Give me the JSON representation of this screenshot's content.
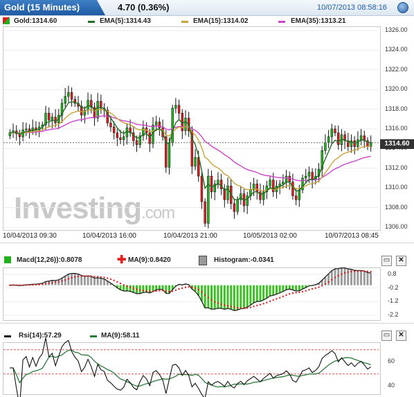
{
  "header": {
    "title": "Gold (15 Minutes)",
    "change": "4.70 (0.36%)",
    "datetime": "10/07/2013 08:58:16"
  },
  "legend_main": {
    "symbol": "Gold:1314.60",
    "ema5": "EMA(5):1314.43",
    "ema15": "EMA(15):1314.02",
    "ema35": "EMA(35):1313.21"
  },
  "legend_macd": {
    "macd": "Macd(12,26)):0.8078",
    "ma": "MA(9):0.8420",
    "hist": "Histogram:-0.0341"
  },
  "legend_rsi": {
    "rsi": "Rsi(14):57.29",
    "ma": "MA(9):58.11"
  },
  "current_price_label": "1314.60",
  "watermark": {
    "main": "Investing",
    "suffix": ".com"
  },
  "colors": {
    "up": "#22b01e",
    "down": "#d91f1f",
    "ema5": "#1f6e1f",
    "ema15": "#c9a23a",
    "ema35": "#cc44cc",
    "macd_line": "#222222",
    "macd_ma": "#e02020",
    "hist_pos": "#9a9a9a",
    "hist_neg": "#37c21f",
    "rsi": "#111111",
    "rsi_ma": "#2a7a3a"
  },
  "chart_data": [
    {
      "type": "candlestick",
      "title": "Gold (15 Minutes)",
      "x_tick_labels": [
        "10/04/2013 09:30",
        "10/04/2013 16:00",
        "10/04/2013 21:00",
        "10/05/2013 02:00",
        "10/07/2013 08:45"
      ],
      "ylim": [
        1306,
        1326
      ],
      "y_ticks": [
        "1326.00",
        "1324.00",
        "1322.00",
        "1320.00",
        "1318.00",
        "1316.00",
        "1314.00",
        "1312.00",
        "1310.00",
        "1308.00",
        "1306.00"
      ],
      "last_price": 1314.6,
      "close": [
        1315.6,
        1315.8,
        1315.5,
        1315.2,
        1315.9,
        1316.0,
        1315.8,
        1316.1,
        1315.9,
        1316.2,
        1316.4,
        1317.6,
        1316.9,
        1317.2,
        1316.6,
        1317.4,
        1318.6,
        1319.3,
        1319.7,
        1319.0,
        1318.6,
        1318.3,
        1317.4,
        1317.9,
        1318.9,
        1318.2,
        1317.1,
        1318.8,
        1318.1,
        1317.9,
        1316.6,
        1316.2,
        1315.6,
        1315.1,
        1314.9,
        1315.2,
        1316.1,
        1315.6,
        1314.8,
        1314.4,
        1315.3,
        1316.1,
        1315.6,
        1314.5,
        1316.4,
        1316.7,
        1316.1,
        1315.2,
        1312.1,
        1314.6,
        1318.1,
        1318.4,
        1317.6,
        1315.8,
        1317.1,
        1315.8,
        1312.2,
        1313.1,
        1311.2,
        1308.6,
        1306.4,
        1311.2,
        1309.6,
        1310.4,
        1310.8,
        1309.9,
        1308.8,
        1310.2,
        1308.4,
        1307.6,
        1308.8,
        1309.4,
        1308.2,
        1309.2,
        1309.8,
        1310.4,
        1309.6,
        1308.8,
        1309.6,
        1310.2,
        1310.8,
        1309.6,
        1310.2,
        1310.4,
        1310.6,
        1311.2,
        1310.6,
        1309.2,
        1308.8,
        1309.8,
        1311.0,
        1311.2,
        1311.6,
        1310.8,
        1311.2,
        1311.9,
        1313.8,
        1314.6,
        1315.2,
        1316.0,
        1315.6,
        1314.4,
        1315.4,
        1314.8,
        1314.2,
        1314.8,
        1314.2,
        1314.9,
        1315.3,
        1314.8,
        1314.2,
        1314.6
      ],
      "series": [
        {
          "name": "EMA(5)",
          "last": 1314.43
        },
        {
          "name": "EMA(15)",
          "last": 1314.02
        },
        {
          "name": "EMA(35)",
          "last": 1313.21
        }
      ]
    },
    {
      "type": "bar",
      "title": "Macd(12,26))",
      "ylim": [
        -2.4,
        1.2
      ],
      "y_ticks": [
        "0.8",
        "-0.2",
        "-1.2",
        "-2.2"
      ],
      "series": [
        {
          "name": "Macd(12,26))",
          "last": 0.8078
        },
        {
          "name": "MA(9)",
          "last": 0.842
        },
        {
          "name": "Histogram",
          "last": -0.0341
        }
      ]
    },
    {
      "type": "line",
      "title": "Rsi(14)",
      "ylim": [
        35,
        75
      ],
      "y_ticks": [
        "60",
        "40"
      ],
      "guide_lines": [
        70,
        50
      ],
      "series": [
        {
          "name": "Rsi(14)",
          "last": 57.29
        },
        {
          "name": "MA(9)",
          "last": 58.11
        }
      ]
    }
  ]
}
